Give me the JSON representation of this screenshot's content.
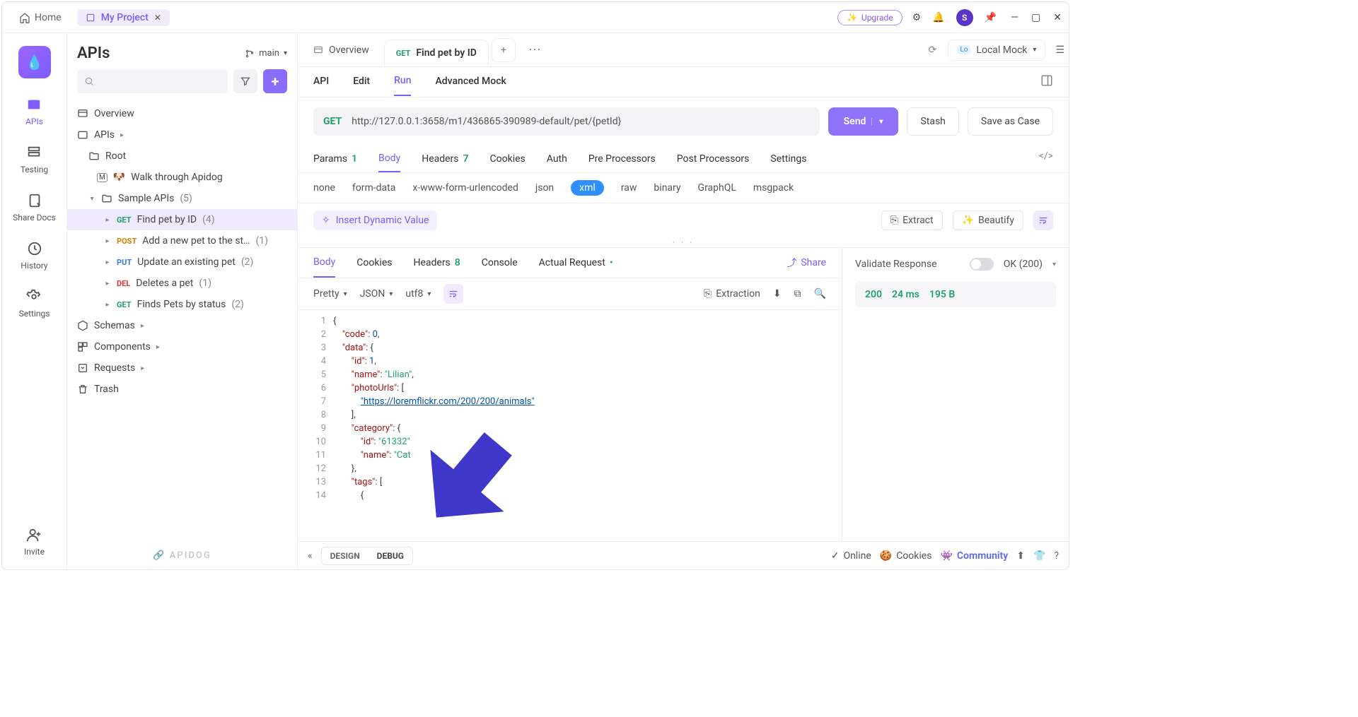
{
  "titlebar": {
    "home": "Home",
    "project_tab": "My Project",
    "upgrade": "Upgrade",
    "avatar_letter": "S"
  },
  "rail": {
    "items": [
      "APIs",
      "Testing",
      "Share Docs",
      "History",
      "Settings"
    ],
    "invite": "Invite"
  },
  "sidebar": {
    "title": "APIs",
    "branch": "main",
    "overview": "Overview",
    "apis_label": "APIs",
    "root": "Root",
    "walk": "Walk through Apidog",
    "sample_folder": "Sample APIs",
    "sample_count": "(5)",
    "endpoints": [
      {
        "method": "GET",
        "mclass": "m-get",
        "name": "Find pet by ID",
        "count": "(4)"
      },
      {
        "method": "POST",
        "mclass": "m-post",
        "name": "Add a new pet to the st…",
        "count": "(1)"
      },
      {
        "method": "PUT",
        "mclass": "m-put",
        "name": "Update an existing pet",
        "count": "(2)"
      },
      {
        "method": "DEL",
        "mclass": "m-del",
        "name": "Deletes a pet",
        "count": "(1)"
      },
      {
        "method": "GET",
        "mclass": "m-get",
        "name": "Finds Pets by status",
        "count": "(2)"
      }
    ],
    "schemas": "Schemas",
    "components": "Components",
    "requests": "Requests",
    "trash": "Trash",
    "brand": "🔗 APIDOG"
  },
  "tabs": {
    "overview": "Overview",
    "active_method": "GET",
    "active_name": "Find pet by ID",
    "env_prefix": "Lo",
    "env_name": "Local Mock"
  },
  "subtabs": [
    "API",
    "Edit",
    "Run",
    "Advanced Mock"
  ],
  "url": {
    "method": "GET",
    "value": "http://127.0.0.1:3658/m1/436865-390989-default/pet/{petId}",
    "send": "Send",
    "stash": "Stash",
    "save_case": "Save as Case"
  },
  "reqtabs": {
    "params": "Params",
    "params_badge": "1",
    "body": "Body",
    "headers": "Headers",
    "headers_badge": "7",
    "cookies": "Cookies",
    "auth": "Auth",
    "pre": "Pre Processors",
    "post": "Post Processors",
    "settings": "Settings"
  },
  "content_types": [
    "none",
    "form-data",
    "x-www-form-urlencoded",
    "json",
    "xml",
    "raw",
    "binary",
    "GraphQL",
    "msgpack"
  ],
  "dynamic": {
    "insert": "Insert Dynamic Value",
    "extract": "Extract",
    "beautify": "Beautify"
  },
  "response_tabs": {
    "body": "Body",
    "cookies": "Cookies",
    "headers": "Headers",
    "headers_badge": "8",
    "console": "Console",
    "actual": "Actual Request",
    "share": "Share"
  },
  "viewer": {
    "pretty": "Pretty",
    "json": "JSON",
    "enc": "utf8",
    "extraction": "Extraction"
  },
  "code": {
    "l1": "{",
    "l2": [
      "    ",
      "\"code\"",
      ": ",
      "0",
      ","
    ],
    "l3": [
      "    ",
      "\"data\"",
      ": {"
    ],
    "l4": [
      "        ",
      "\"id\"",
      ": ",
      "1",
      ","
    ],
    "l5": [
      "        ",
      "\"name\"",
      ": ",
      "\"Lilian\"",
      ","
    ],
    "l6": [
      "        ",
      "\"photoUrls\"",
      ": ["
    ],
    "l7": [
      "            ",
      "\"https://loremflickr.com/200/200/animals\""
    ],
    "l8": "        ],",
    "l9": [
      "        ",
      "\"category\"",
      ": {"
    ],
    "l10": [
      "            ",
      "\"id\"",
      ": ",
      "\"61332\""
    ],
    "l11": [
      "            ",
      "\"name\"",
      ": ",
      "\"Cat"
    ],
    "l12": "        },",
    "l13": [
      "        ",
      "\"tags\"",
      ": ["
    ],
    "l14": "            {"
  },
  "validate": {
    "label": "Validate Response",
    "status": "OK (200)"
  },
  "metrics": {
    "code": "200",
    "time": "24 ms",
    "size": "195 B"
  },
  "footer": {
    "design": "DESIGN",
    "debug": "DEBUG",
    "online": "Online",
    "cookies": "Cookies",
    "community": "Community"
  }
}
